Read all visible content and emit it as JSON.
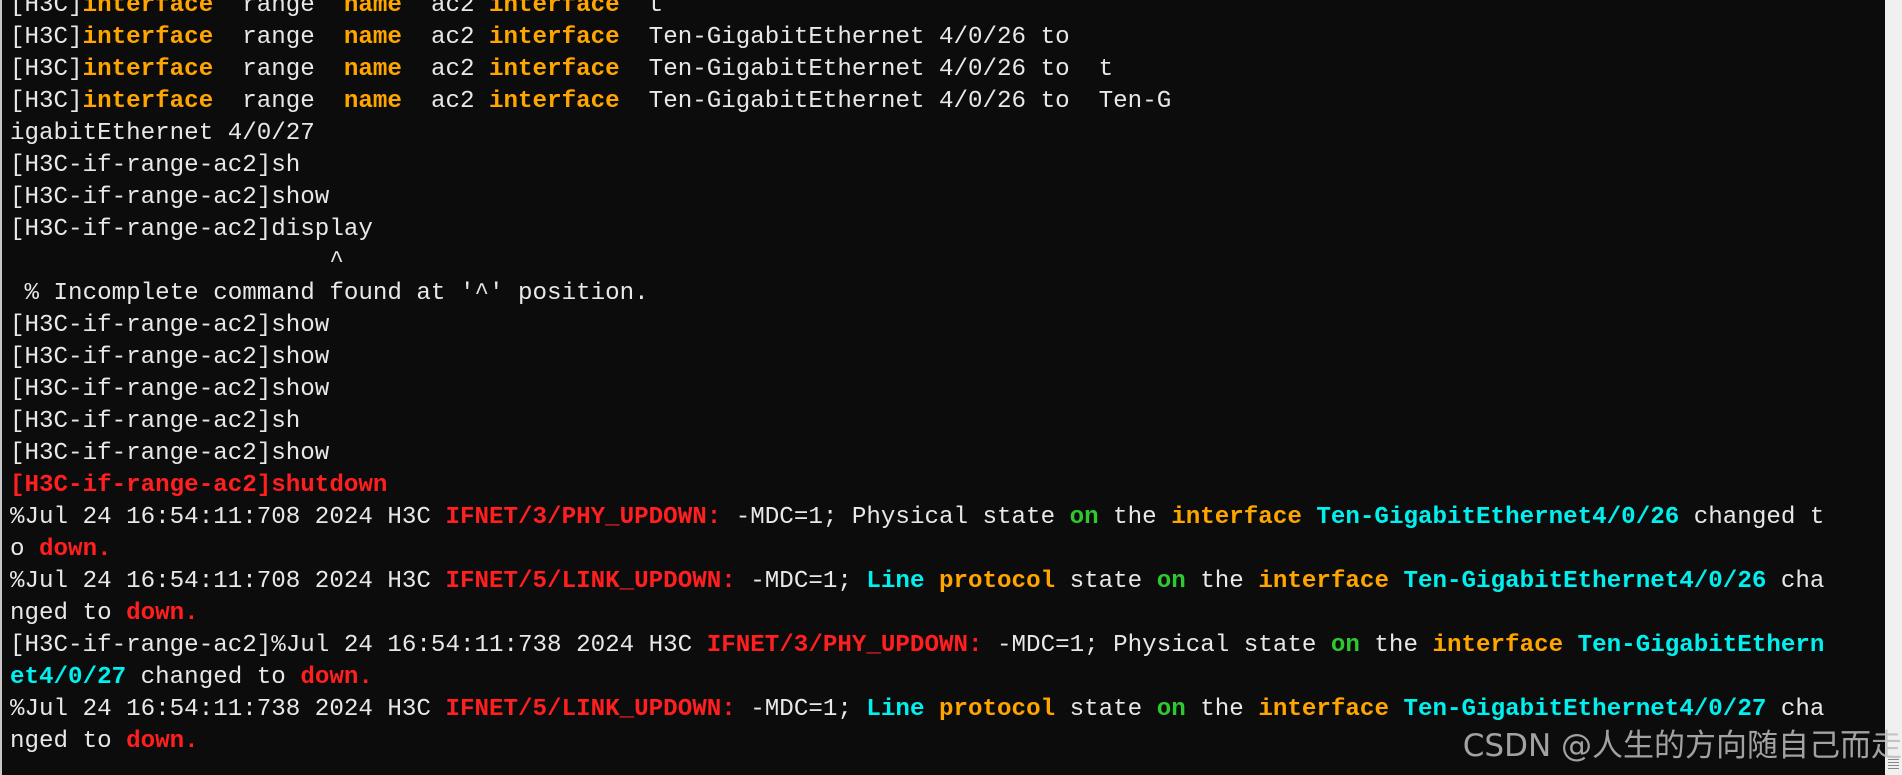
{
  "terminal": {
    "lines": [
      [
        [
          "w",
          "[H3C]"
        ],
        [
          "o",
          "interface"
        ],
        [
          "w",
          "  range  "
        ],
        [
          "o",
          "name"
        ],
        [
          "w",
          "  ac2 "
        ],
        [
          "o",
          "interface"
        ],
        [
          "w",
          "  t"
        ]
      ],
      [
        [
          "w",
          "[H3C]"
        ],
        [
          "o",
          "interface"
        ],
        [
          "w",
          "  range  "
        ],
        [
          "o",
          "name"
        ],
        [
          "w",
          "  ac2 "
        ],
        [
          "o",
          "interface"
        ],
        [
          "w",
          "  Ten-GigabitEthernet 4/0/26 to"
        ]
      ],
      [
        [
          "w",
          "[H3C]"
        ],
        [
          "o",
          "interface"
        ],
        [
          "w",
          "  range  "
        ],
        [
          "o",
          "name"
        ],
        [
          "w",
          "  ac2 "
        ],
        [
          "o",
          "interface"
        ],
        [
          "w",
          "  Ten-GigabitEthernet 4/0/26 to  t"
        ]
      ],
      [
        [
          "w",
          "[H3C]"
        ],
        [
          "o",
          "interface"
        ],
        [
          "w",
          "  range  "
        ],
        [
          "o",
          "name"
        ],
        [
          "w",
          "  ac2 "
        ],
        [
          "o",
          "interface"
        ],
        [
          "w",
          "  Ten-GigabitEthernet 4/0/26 to  Ten-G"
        ]
      ],
      [
        [
          "w",
          "igabitEthernet 4/0/27"
        ]
      ],
      [
        [
          "w",
          "[H3C-if-range-ac2]sh"
        ]
      ],
      [
        [
          "w",
          "[H3C-if-range-ac2]show"
        ]
      ],
      [
        [
          "w",
          "[H3C-if-range-ac2]display"
        ]
      ],
      [
        [
          "w",
          "                      ^"
        ]
      ],
      [
        [
          "w",
          " % Incomplete command found at '^' position."
        ]
      ],
      [
        [
          "w",
          "[H3C-if-range-ac2]show"
        ]
      ],
      [
        [
          "w",
          "[H3C-if-range-ac2]show"
        ]
      ],
      [
        [
          "w",
          "[H3C-if-range-ac2]show"
        ]
      ],
      [
        [
          "w",
          "[H3C-if-range-ac2]sh"
        ]
      ],
      [
        [
          "w",
          "[H3C-if-range-ac2]show"
        ]
      ],
      [
        [
          "r",
          "[H3C-if-range-ac2]shutdown"
        ]
      ],
      [
        [
          "w",
          "%Jul 24 16:54:11:708 2024 H3C "
        ],
        [
          "r",
          "IFNET/3/PHY_UPDOWN:"
        ],
        [
          "w",
          " -MDC=1; Physical state "
        ],
        [
          "g",
          "on"
        ],
        [
          "w",
          " the "
        ],
        [
          "o",
          "interface"
        ],
        [
          "w",
          " "
        ],
        [
          "c",
          "Ten-GigabitEthernet4/0/26"
        ],
        [
          "w",
          " changed t"
        ]
      ],
      [
        [
          "w",
          "o "
        ],
        [
          "r",
          "down."
        ]
      ],
      [
        [
          "w",
          "%Jul 24 16:54:11:708 2024 H3C "
        ],
        [
          "r",
          "IFNET/5/LINK_UPDOWN:"
        ],
        [
          "w",
          " -MDC=1; "
        ],
        [
          "c",
          "Line"
        ],
        [
          "w",
          " "
        ],
        [
          "o",
          "protocol"
        ],
        [
          "w",
          " state "
        ],
        [
          "g",
          "on"
        ],
        [
          "w",
          " the "
        ],
        [
          "o",
          "interface"
        ],
        [
          "w",
          " "
        ],
        [
          "c",
          "Ten-GigabitEthernet4/0/26"
        ],
        [
          "w",
          " cha"
        ]
      ],
      [
        [
          "w",
          "nged to "
        ],
        [
          "r",
          "down."
        ]
      ],
      [
        [
          "w",
          "[H3C-if-range-ac2]%Jul 24 16:54:11:738 2024 H3C "
        ],
        [
          "r",
          "IFNET/3/PHY_UPDOWN:"
        ],
        [
          "w",
          " -MDC=1; Physical state "
        ],
        [
          "g",
          "on"
        ],
        [
          "w",
          " the "
        ],
        [
          "o",
          "interface"
        ],
        [
          "w",
          " "
        ],
        [
          "c",
          "Ten-GigabitEthern"
        ]
      ],
      [
        [
          "c",
          "et4/0/27"
        ],
        [
          "w",
          " changed to "
        ],
        [
          "r",
          "down."
        ]
      ],
      [
        [
          "w",
          "%Jul 24 16:54:11:738 2024 H3C "
        ],
        [
          "r",
          "IFNET/5/LINK_UPDOWN:"
        ],
        [
          "w",
          " -MDC=1; "
        ],
        [
          "c",
          "Line"
        ],
        [
          "w",
          " "
        ],
        [
          "o",
          "protocol"
        ],
        [
          "w",
          " state "
        ],
        [
          "g",
          "on"
        ],
        [
          "w",
          " the "
        ],
        [
          "o",
          "interface"
        ],
        [
          "w",
          " "
        ],
        [
          "c",
          "Ten-GigabitEthernet4/0/27"
        ],
        [
          "w",
          " cha"
        ]
      ],
      [
        [
          "w",
          "nged to "
        ],
        [
          "r",
          "down."
        ]
      ]
    ]
  },
  "colors": {
    "background": "#0c0c0c",
    "text": "#e8e8e8",
    "keyword": "#ffa500",
    "alert": "#ff1f1f",
    "ok": "#2fc82f",
    "interface": "#00f0f0"
  },
  "watermark": "CSDN @人生的方向随自己而走"
}
